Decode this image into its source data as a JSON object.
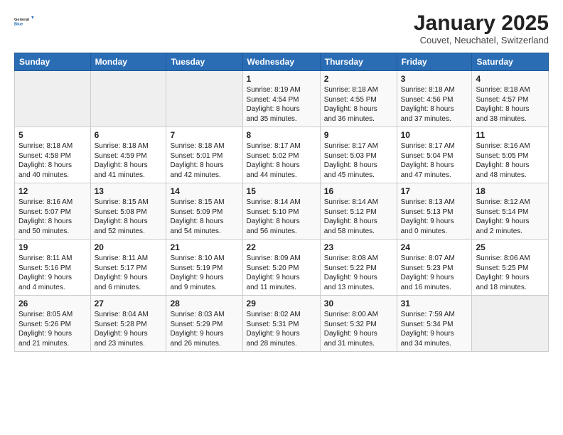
{
  "header": {
    "logo_general": "General",
    "logo_blue": "Blue",
    "title": "January 2025",
    "subtitle": "Couvet, Neuchatel, Switzerland"
  },
  "weekdays": [
    "Sunday",
    "Monday",
    "Tuesday",
    "Wednesday",
    "Thursday",
    "Friday",
    "Saturday"
  ],
  "weeks": [
    [
      {
        "day": "",
        "info": "",
        "empty": true
      },
      {
        "day": "",
        "info": "",
        "empty": true
      },
      {
        "day": "",
        "info": "",
        "empty": true
      },
      {
        "day": "1",
        "info": "Sunrise: 8:19 AM\nSunset: 4:54 PM\nDaylight: 8 hours\nand 35 minutes.",
        "empty": false
      },
      {
        "day": "2",
        "info": "Sunrise: 8:18 AM\nSunset: 4:55 PM\nDaylight: 8 hours\nand 36 minutes.",
        "empty": false
      },
      {
        "day": "3",
        "info": "Sunrise: 8:18 AM\nSunset: 4:56 PM\nDaylight: 8 hours\nand 37 minutes.",
        "empty": false
      },
      {
        "day": "4",
        "info": "Sunrise: 8:18 AM\nSunset: 4:57 PM\nDaylight: 8 hours\nand 38 minutes.",
        "empty": false
      }
    ],
    [
      {
        "day": "5",
        "info": "Sunrise: 8:18 AM\nSunset: 4:58 PM\nDaylight: 8 hours\nand 40 minutes.",
        "empty": false
      },
      {
        "day": "6",
        "info": "Sunrise: 8:18 AM\nSunset: 4:59 PM\nDaylight: 8 hours\nand 41 minutes.",
        "empty": false
      },
      {
        "day": "7",
        "info": "Sunrise: 8:18 AM\nSunset: 5:01 PM\nDaylight: 8 hours\nand 42 minutes.",
        "empty": false
      },
      {
        "day": "8",
        "info": "Sunrise: 8:17 AM\nSunset: 5:02 PM\nDaylight: 8 hours\nand 44 minutes.",
        "empty": false
      },
      {
        "day": "9",
        "info": "Sunrise: 8:17 AM\nSunset: 5:03 PM\nDaylight: 8 hours\nand 45 minutes.",
        "empty": false
      },
      {
        "day": "10",
        "info": "Sunrise: 8:17 AM\nSunset: 5:04 PM\nDaylight: 8 hours\nand 47 minutes.",
        "empty": false
      },
      {
        "day": "11",
        "info": "Sunrise: 8:16 AM\nSunset: 5:05 PM\nDaylight: 8 hours\nand 48 minutes.",
        "empty": false
      }
    ],
    [
      {
        "day": "12",
        "info": "Sunrise: 8:16 AM\nSunset: 5:07 PM\nDaylight: 8 hours\nand 50 minutes.",
        "empty": false
      },
      {
        "day": "13",
        "info": "Sunrise: 8:15 AM\nSunset: 5:08 PM\nDaylight: 8 hours\nand 52 minutes.",
        "empty": false
      },
      {
        "day": "14",
        "info": "Sunrise: 8:15 AM\nSunset: 5:09 PM\nDaylight: 8 hours\nand 54 minutes.",
        "empty": false
      },
      {
        "day": "15",
        "info": "Sunrise: 8:14 AM\nSunset: 5:10 PM\nDaylight: 8 hours\nand 56 minutes.",
        "empty": false
      },
      {
        "day": "16",
        "info": "Sunrise: 8:14 AM\nSunset: 5:12 PM\nDaylight: 8 hours\nand 58 minutes.",
        "empty": false
      },
      {
        "day": "17",
        "info": "Sunrise: 8:13 AM\nSunset: 5:13 PM\nDaylight: 9 hours\nand 0 minutes.",
        "empty": false
      },
      {
        "day": "18",
        "info": "Sunrise: 8:12 AM\nSunset: 5:14 PM\nDaylight: 9 hours\nand 2 minutes.",
        "empty": false
      }
    ],
    [
      {
        "day": "19",
        "info": "Sunrise: 8:11 AM\nSunset: 5:16 PM\nDaylight: 9 hours\nand 4 minutes.",
        "empty": false
      },
      {
        "day": "20",
        "info": "Sunrise: 8:11 AM\nSunset: 5:17 PM\nDaylight: 9 hours\nand 6 minutes.",
        "empty": false
      },
      {
        "day": "21",
        "info": "Sunrise: 8:10 AM\nSunset: 5:19 PM\nDaylight: 9 hours\nand 9 minutes.",
        "empty": false
      },
      {
        "day": "22",
        "info": "Sunrise: 8:09 AM\nSunset: 5:20 PM\nDaylight: 9 hours\nand 11 minutes.",
        "empty": false
      },
      {
        "day": "23",
        "info": "Sunrise: 8:08 AM\nSunset: 5:22 PM\nDaylight: 9 hours\nand 13 minutes.",
        "empty": false
      },
      {
        "day": "24",
        "info": "Sunrise: 8:07 AM\nSunset: 5:23 PM\nDaylight: 9 hours\nand 16 minutes.",
        "empty": false
      },
      {
        "day": "25",
        "info": "Sunrise: 8:06 AM\nSunset: 5:25 PM\nDaylight: 9 hours\nand 18 minutes.",
        "empty": false
      }
    ],
    [
      {
        "day": "26",
        "info": "Sunrise: 8:05 AM\nSunset: 5:26 PM\nDaylight: 9 hours\nand 21 minutes.",
        "empty": false
      },
      {
        "day": "27",
        "info": "Sunrise: 8:04 AM\nSunset: 5:28 PM\nDaylight: 9 hours\nand 23 minutes.",
        "empty": false
      },
      {
        "day": "28",
        "info": "Sunrise: 8:03 AM\nSunset: 5:29 PM\nDaylight: 9 hours\nand 26 minutes.",
        "empty": false
      },
      {
        "day": "29",
        "info": "Sunrise: 8:02 AM\nSunset: 5:31 PM\nDaylight: 9 hours\nand 28 minutes.",
        "empty": false
      },
      {
        "day": "30",
        "info": "Sunrise: 8:00 AM\nSunset: 5:32 PM\nDaylight: 9 hours\nand 31 minutes.",
        "empty": false
      },
      {
        "day": "31",
        "info": "Sunrise: 7:59 AM\nSunset: 5:34 PM\nDaylight: 9 hours\nand 34 minutes.",
        "empty": false
      },
      {
        "day": "",
        "info": "",
        "empty": true
      }
    ]
  ]
}
